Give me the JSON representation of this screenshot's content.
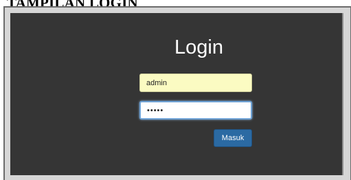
{
  "document": {
    "heading": "TAMPILAN LOGIN"
  },
  "login": {
    "title": "Login",
    "username_value": "admin",
    "password_mask": "•••••",
    "submit_label": "Masuk"
  },
  "colors": {
    "panel_background": "#353535",
    "username_background": "#fbfbc2",
    "button_background": "#2b6aa3",
    "focus_border": "#6fa3d6"
  }
}
